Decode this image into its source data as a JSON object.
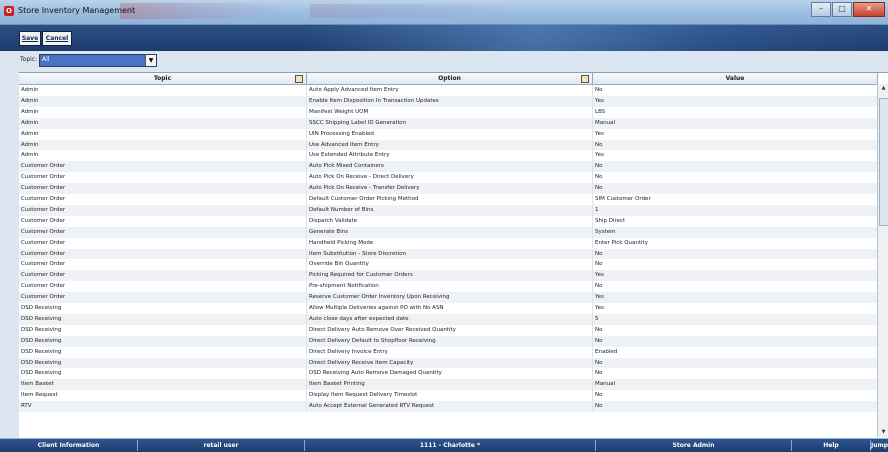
{
  "window": {
    "title": "Store Inventory Management",
    "app_icon": "oracle-icon"
  },
  "toolbar": {
    "save_label": "Save",
    "cancel_label": "Cancel"
  },
  "filter": {
    "label": "Topic:",
    "value": "All"
  },
  "grid": {
    "columns": [
      "Topic",
      "Option",
      "Value"
    ],
    "rows": [
      [
        "Admin",
        "Auto Apply Advanced Item Entry",
        "No"
      ],
      [
        "Admin",
        "Enable Item Disposition In Transaction Updates",
        "Yes"
      ],
      [
        "Admin",
        "Manifest Weight UOM",
        "LBS"
      ],
      [
        "Admin",
        "SSCC Shipping Label ID Generation",
        "Manual"
      ],
      [
        "Admin",
        "UIN Processing Enabled",
        "Yes"
      ],
      [
        "Admin",
        "Use Advanced Item Entry",
        "No"
      ],
      [
        "Admin",
        "Use Extended Attribute Entry",
        "Yes"
      ],
      [
        "Customer Order",
        "Auto Pick Mixed Containers",
        "No"
      ],
      [
        "Customer Order",
        "Auto Pick On Receive - Direct Delivery",
        "No"
      ],
      [
        "Customer Order",
        "Auto Pick On Receive - Transfer Delivery",
        "No"
      ],
      [
        "Customer Order",
        "Default Customer Order Picking Method",
        "SIM Customer Order"
      ],
      [
        "Customer Order",
        "Default Number of Bins",
        "1"
      ],
      [
        "Customer Order",
        "Dispatch Validate",
        "Ship Direct"
      ],
      [
        "Customer Order",
        "Generate Bins",
        "System"
      ],
      [
        "Customer Order",
        "Handheld Picking Mode",
        "Enter Pick Quantity"
      ],
      [
        "Customer Order",
        "Item Substitution - Store Discretion",
        "No"
      ],
      [
        "Customer Order",
        "Override Bin Quantity",
        "No"
      ],
      [
        "Customer Order",
        "Picking Required for Customer Orders",
        "Yes"
      ],
      [
        "Customer Order",
        "Pre-shipment Notification",
        "No"
      ],
      [
        "Customer Order",
        "Reserve Customer Order Inventory Upon Receiving",
        "Yes"
      ],
      [
        "DSD Receiving",
        "Allow Multiple Deliveries against PO with No ASN",
        "Yes"
      ],
      [
        "DSD Receiving",
        "Auto close days after expected date",
        "5"
      ],
      [
        "DSD Receiving",
        "Direct Delivery Auto Remove Over Received Quantity",
        "No"
      ],
      [
        "DSD Receiving",
        "Direct Delivery Default to Shopfloor Receiving",
        "No"
      ],
      [
        "DSD Receiving",
        "Direct Delivery Invoice Entry",
        "Enabled"
      ],
      [
        "DSD Receiving",
        "Direct Delivery Receive Item Capacity",
        "No"
      ],
      [
        "DSD Receiving",
        "DSD Receiving Auto Remove Damaged Quantity",
        "No"
      ],
      [
        "Item Basket",
        "Item Basket Printing",
        "Manual"
      ],
      [
        "Item Request",
        "Display Item Request Delivery Timeslot",
        "No"
      ],
      [
        "RTV",
        "Auto Accept External Generated RTV Request",
        "No"
      ]
    ]
  },
  "status": {
    "client_info": "Client Information",
    "user": "retail user",
    "store": "1111 - Charlotte *",
    "role": "Store Admin",
    "help": "Help",
    "jump": "Jump"
  },
  "colors": {
    "toolbar": "#1d3c6c",
    "select": "#4a73c8",
    "status": "#1d3c6c"
  }
}
